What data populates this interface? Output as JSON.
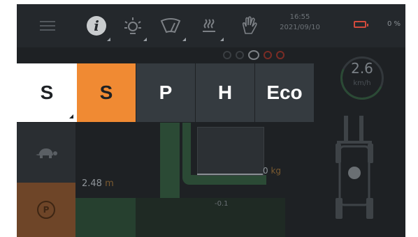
{
  "topbar": {
    "icons": [
      "menu-icon",
      "info-icon",
      "light-icon",
      "wiper-icon",
      "heater-icon",
      "glove-icon"
    ],
    "time": "16:55",
    "date": "2021/09/10",
    "battery_percent": "0 %",
    "battery_level": 0
  },
  "modes": [
    {
      "label": "S",
      "state": "selected-white"
    },
    {
      "label": "S",
      "state": "active-orange"
    },
    {
      "label": "P",
      "state": "normal"
    },
    {
      "label": "H",
      "state": "normal"
    },
    {
      "label": "Eco",
      "state": "normal"
    }
  ],
  "sidebar": {
    "turtle_icon": "turtle-icon",
    "brake_icon": "parking-brake-icon",
    "brake_label": "P"
  },
  "lift": {
    "height_value": "2.48",
    "height_unit": "m",
    "load_value": "0",
    "load_unit": "kg",
    "tilt_value": "-0.1"
  },
  "speed": {
    "value": "2.6",
    "unit": "km/h"
  },
  "colors": {
    "accent_orange": "#f08a33",
    "tile": "#353b40",
    "background": "#1e2124",
    "brake": "#6e4528",
    "battery_low": "#d24a3c"
  }
}
